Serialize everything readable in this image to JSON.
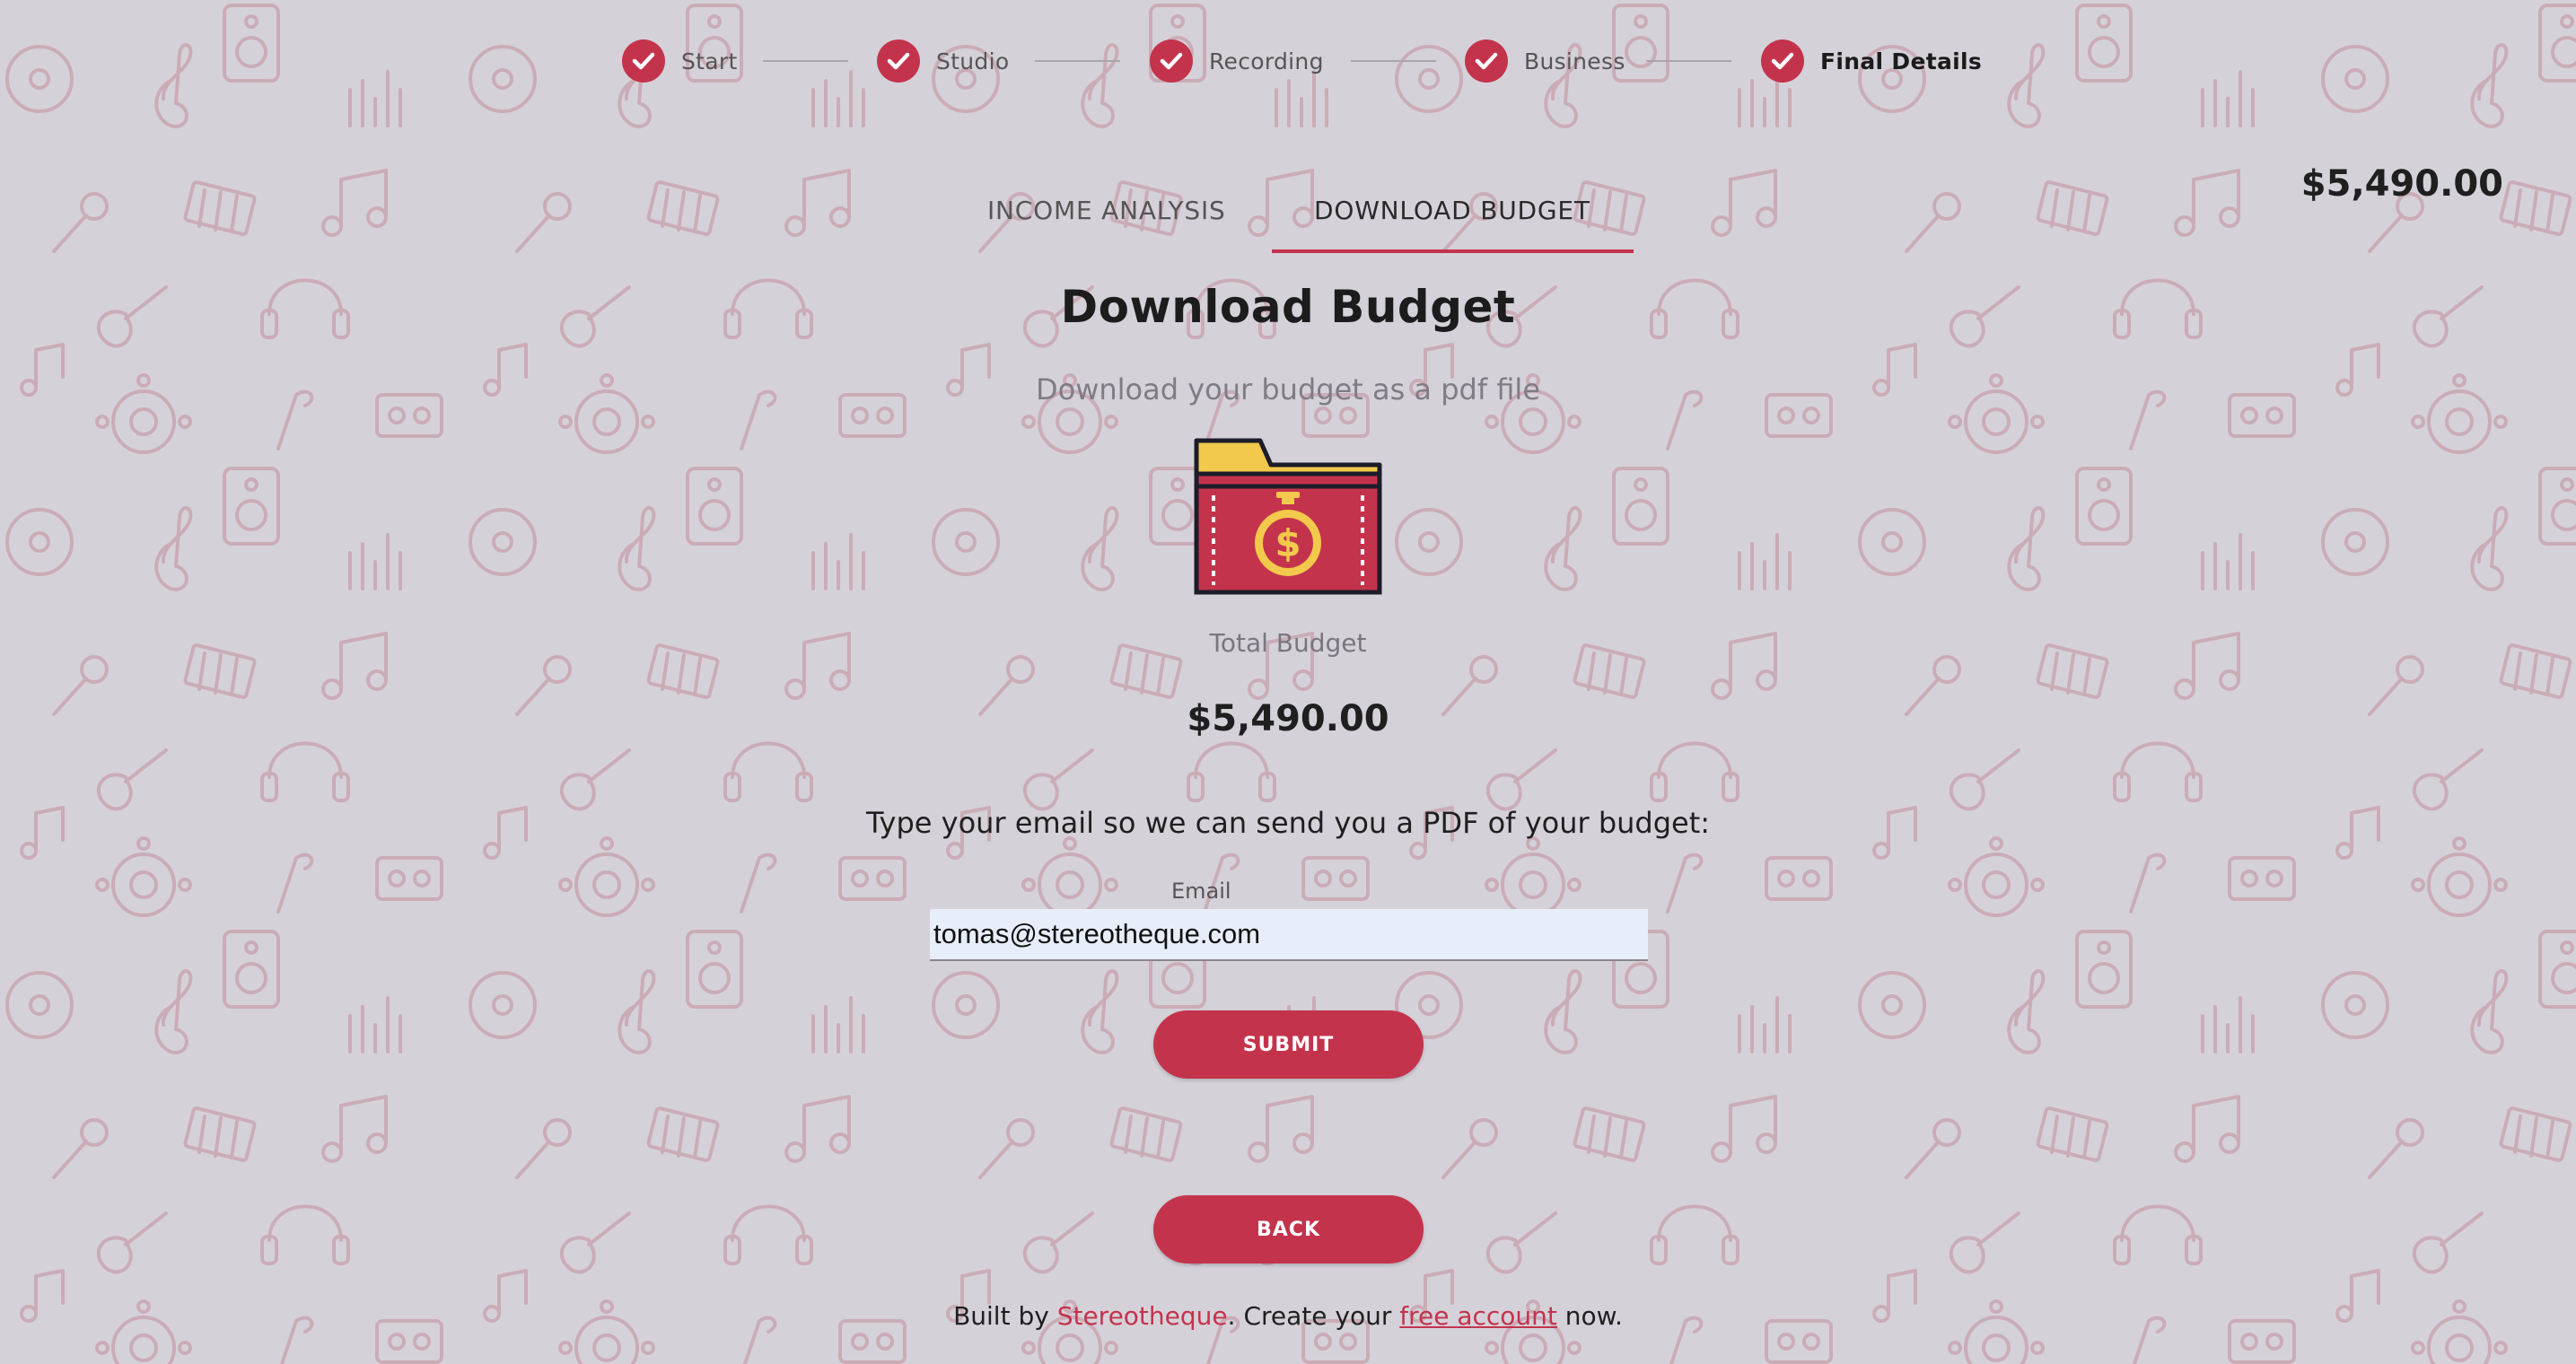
{
  "theme": {
    "accent": "#c4334c",
    "background": "#d5d1d9",
    "folder_tab": "#f2c94c",
    "folder_body": "#c4334c"
  },
  "stepper": {
    "steps": [
      {
        "label": "Start",
        "status": "complete"
      },
      {
        "label": "Studio",
        "status": "complete"
      },
      {
        "label": "Recording",
        "status": "complete"
      },
      {
        "label": "Business",
        "status": "complete"
      },
      {
        "label": "Final Details",
        "status": "complete-active"
      }
    ]
  },
  "tabs": [
    {
      "label": "INCOME ANALYSIS",
      "active": false
    },
    {
      "label": "DOWNLOAD BUDGET",
      "active": true
    }
  ],
  "header": {
    "total": "$5,490.00"
  },
  "main": {
    "title": "Download Budget",
    "subtitle": "Download your budget as a pdf file",
    "icon": "folder-dollar-stopwatch-icon",
    "total_label": "Total Budget",
    "total_value": "$5,490.00",
    "email_prompt": "Type your email so we can send you a PDF of your budget:",
    "email_label": "Email",
    "email_value": "tomas@stereotheque.com",
    "submit_label": "SUBMIT",
    "back_label": "BACK"
  },
  "footer": {
    "prefix": "Built by ",
    "brand": "Stereotheque",
    "middle": ". Create your ",
    "link": "free account",
    "suffix": " now."
  }
}
